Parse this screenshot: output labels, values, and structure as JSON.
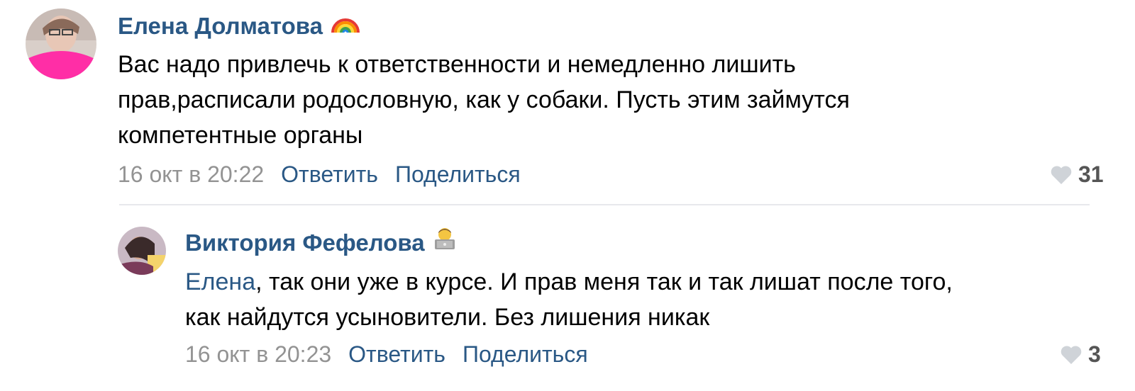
{
  "comments": [
    {
      "author": "Елена Долматова",
      "author_emoji": "rainbow-emoji",
      "text_lines": [
        "Вас надо привлечь к ответственности и немедленно лишить",
        "прав,расписали родословную, как у собаки. Пусть этим займутся",
        "компетентные органы"
      ],
      "date": "16 окт в 20:22",
      "reply_label": "Ответить",
      "share_label": "Поделиться",
      "likes": "31"
    },
    {
      "author": "Виктория Фефелова",
      "author_emoji": "person-laptop-emoji",
      "mention": "Елена",
      "text_first_line_rest": ", так они уже в курсе. И прав меня так и так лишат после того,",
      "text_second_line": "как найдутся усыновители. Без лишения никак",
      "date": "16 окт в 20:23",
      "reply_label": "Ответить",
      "share_label": "Поделиться",
      "likes": "3"
    }
  ],
  "colors": {
    "link": "#2a5885",
    "meta": "#939393",
    "like_icon": "#cfd3d8",
    "divider": "#e7e8ec"
  }
}
